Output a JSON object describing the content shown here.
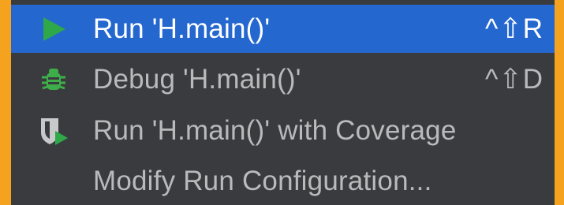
{
  "menu": {
    "items": [
      {
        "label": "Run 'H.main()'",
        "shortcut": "^⇧R",
        "icon": "run-play-icon",
        "selected": true
      },
      {
        "label": "Debug 'H.main()'",
        "shortcut": "^⇧D",
        "icon": "debug-bug-icon",
        "selected": false
      },
      {
        "label": "Run 'H.main()' with Coverage",
        "shortcut": "",
        "icon": "coverage-shield-icon",
        "selected": false
      },
      {
        "label": "Modify Run Configuration...",
        "shortcut": "",
        "icon": "",
        "selected": false
      }
    ]
  },
  "colors": {
    "frame": "#f5a21e",
    "menu_bg": "#3a3b3e",
    "selected_bg": "#2467cf",
    "run_icon": "#2fa84a",
    "debug_icon": "#3eae4a",
    "coverage_icon": "#c8c9cb"
  }
}
